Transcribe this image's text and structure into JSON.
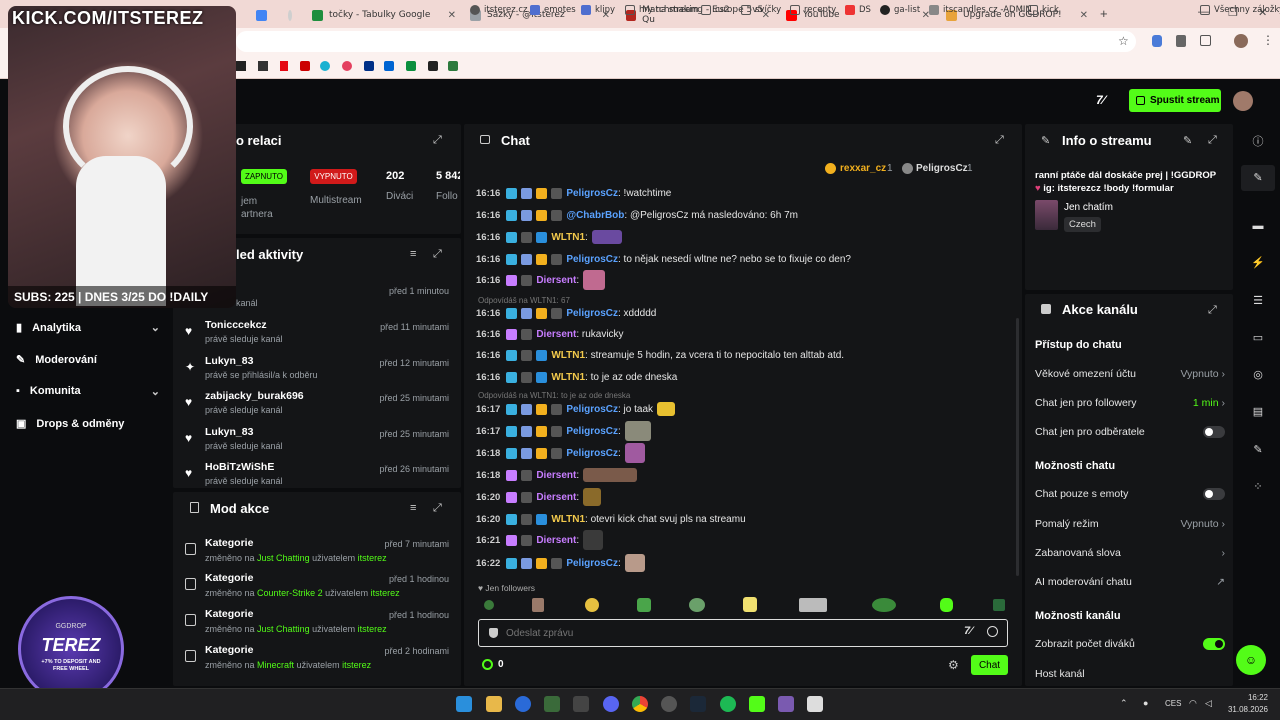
{
  "browser": {
    "tabs": [
      {
        "label": "točky - Tabulky Google",
        "color": "#1e8e3e"
      },
      {
        "label": "Sázky - @itsterez",
        "color": "#9aa0a6"
      },
      {
        "label": "Matchmaking - Europe 5v5 Qu",
        "color": "#b3261e"
      },
      {
        "label": "YouTube",
        "color": "#ff0000"
      },
      {
        "label": "Upgrade on GGDROP!",
        "color": "#e8a33a"
      }
    ],
    "bookmarks": [
      "itsterez.cz",
      "emotes",
      "klipy",
      "hry na stream",
      "cs2",
      "svíčky",
      "recepty",
      "DS",
      "ga-list",
      "itscandles.cz -ADMIN",
      "kick"
    ],
    "bookmarks_all": "Všechny záložky"
  },
  "overlay": {
    "kick_url": "KICK.COM/ITSTEREZ",
    "subs_banner": "SUBS: 225 | DNES 3/25 DO !DAILY",
    "ggdrop_brand": "GGDROP",
    "ggdrop_name": "TEREZ",
    "ggdrop_promo": "+7% TO DEPOSIT AND FREE WHEEL"
  },
  "header": {
    "start_stream": "Spustit stream"
  },
  "session": {
    "title": "o relaci",
    "enabled_badge": "ZAPNUTO",
    "disabled_badge": "VYPNUTO",
    "multistream": "Multistream",
    "revenue_label_1": "jem",
    "revenue_label_2": "artnera",
    "viewers_value": "202",
    "viewers_label": "Diváci",
    "followers_value": "5 842",
    "followers_label": "Follo"
  },
  "activity": {
    "title": "led aktivity",
    "items": [
      {
        "name": "oS",
        "sub": "sleduje kanál",
        "time": "před 1 minutou"
      },
      {
        "name": "Tonicccekcz",
        "sub": "právě sleduje kanál",
        "time": "před 11 minutami"
      },
      {
        "name": "Lukyn_83",
        "sub": "právě se přihlásil/a k odběru",
        "time": "před 12 minutami"
      },
      {
        "name": "zabijacky_burak696",
        "sub": "právě sleduje kanál",
        "time": "před 25 minutami"
      },
      {
        "name": "Lukyn_83",
        "sub": "právě sleduje kanál",
        "time": "před 25 minutami"
      },
      {
        "name": "HoBiTzWiShE",
        "sub": "právě sleduje kanál",
        "time": "před 26 minutami"
      }
    ]
  },
  "sidebar": {
    "items": [
      {
        "label": "Analytika",
        "chevron": true
      },
      {
        "label": "Moderování",
        "chevron": false
      },
      {
        "label": "Komunita",
        "chevron": true
      },
      {
        "label": "Drops & odměny",
        "chevron": false
      }
    ]
  },
  "mod_actions": {
    "title": "Mod akce",
    "items": [
      {
        "title": "Kategorie",
        "pre": "změněno na ",
        "cat": "Just Chatting",
        "mid": " uživatelem ",
        "user": "itsterez",
        "time": "před 7 minutami"
      },
      {
        "title": "Kategorie",
        "pre": "změněno na ",
        "cat": "Counter-Strike 2",
        "mid": " uživatelem ",
        "user": "itsterez",
        "time": "před 1 hodinou"
      },
      {
        "title": "Kategorie",
        "pre": "změněno na ",
        "cat": "Just Chatting",
        "mid": " uživatelem ",
        "user": "itsterez",
        "time": "před 1 hodinou"
      },
      {
        "title": "Kategorie",
        "pre": "změněno na ",
        "cat": "Minecraft",
        "mid": " uživatelem ",
        "user": "itsterez",
        "time": "před 2 hodinami"
      }
    ]
  },
  "chat": {
    "title": "Chat",
    "pinned_1": "rexxar_cz",
    "pinned_1_count": "1",
    "pinned_2": "PeligrosCz",
    "pinned_2_count": "1",
    "messages": [
      {
        "time": "16:16",
        "user": "PeligrosCz",
        "ucolor": "#5aa2ff",
        "text": ": !watchtime"
      },
      {
        "time": "16:16",
        "user": "@ChabrBob",
        "ucolor": "#5aa2ff",
        "text": ": @PeligrosCz má nasledováno: 6h 7m"
      },
      {
        "time": "16:16",
        "user": "WLTN1",
        "ucolor": "#f2c94c",
        "text": ":"
      },
      {
        "time": "16:16",
        "user": "PeligrosCz",
        "ucolor": "#5aa2ff",
        "text": ": to nějak nesedí wltne ne? nebo se to fixuje co den?"
      },
      {
        "time": "16:16",
        "user": "Diersent",
        "ucolor": "#c77dff",
        "text": ":"
      },
      {
        "time": "16:16",
        "user": "PeligrosCz",
        "ucolor": "#5aa2ff",
        "text": ": xddddd"
      },
      {
        "time": "16:16",
        "user": "Diersent",
        "ucolor": "#c77dff",
        "text": ": rukavicky"
      },
      {
        "time": "16:16",
        "user": "WLTN1",
        "ucolor": "#f2c94c",
        "text": ": streamuje 5 hodin, za vcera ti to nepocitalo ten alttab atd."
      },
      {
        "time": "16:16",
        "user": "WLTN1",
        "ucolor": "#f2c94c",
        "text": ": to je az ode dneska"
      },
      {
        "time": "16:17",
        "user": "PeligrosCz",
        "ucolor": "#5aa2ff",
        "text": ": jo taak"
      },
      {
        "time": "16:17",
        "user": "PeligrosCz",
        "ucolor": "#5aa2ff",
        "text": ":"
      },
      {
        "time": "16:18",
        "user": "PeligrosCz",
        "ucolor": "#5aa2ff",
        "text": ":"
      },
      {
        "time": "16:18",
        "user": "Diersent",
        "ucolor": "#c77dff",
        "text": ":"
      },
      {
        "time": "16:20",
        "user": "Diersent",
        "ucolor": "#c77dff",
        "text": ":"
      },
      {
        "time": "16:20",
        "user": "WLTN1",
        "ucolor": "#f2c94c",
        "text": ": otevri kick chat svuj pls na streamu"
      },
      {
        "time": "16:21",
        "user": "Diersent",
        "ucolor": "#c77dff",
        "text": ":"
      },
      {
        "time": "16:22",
        "user": "PeligrosCz",
        "ucolor": "#5aa2ff",
        "text": ":"
      }
    ],
    "reply_1": "Odpovídáš na WLTN1: 67",
    "reply_2": "Odpovídáš na WLTN1: to je az ode dneska",
    "followers_only": "Jen followers",
    "input_placeholder": "Odeslat zprávu",
    "points": "0",
    "send": "Chat"
  },
  "stream_info": {
    "title": "Info o streamu",
    "line1": "ranní ptáče dál doskáče prej | !GGDROP",
    "line2": "ig: itsterezcz  !body  !formular",
    "category": "Jen chatím",
    "language": "Czech"
  },
  "channel_actions": {
    "title": "Akce kanálu",
    "section_access": "Přístup do chatu",
    "age": "Věkové omezení účtu",
    "age_value": "Vypnuto",
    "followers_only": "Chat jen pro followery",
    "followers_value": "1 min",
    "subs_only": "Chat jen pro odběratele",
    "section_chat": "Možnosti chatu",
    "emote_only": "Chat pouze s emoty",
    "slow": "Pomalý režim",
    "slow_value": "Vypnuto",
    "banned_words": "Zabanovaná slova",
    "ai_mod": "AI moderování chatu",
    "section_channel": "Možnosti kanálu",
    "show_viewers": "Zobrazit počet diváků",
    "host": "Host kanál"
  },
  "taskbar": {
    "lang": "CES",
    "time": "16:22",
    "date": "31.08.2026"
  }
}
